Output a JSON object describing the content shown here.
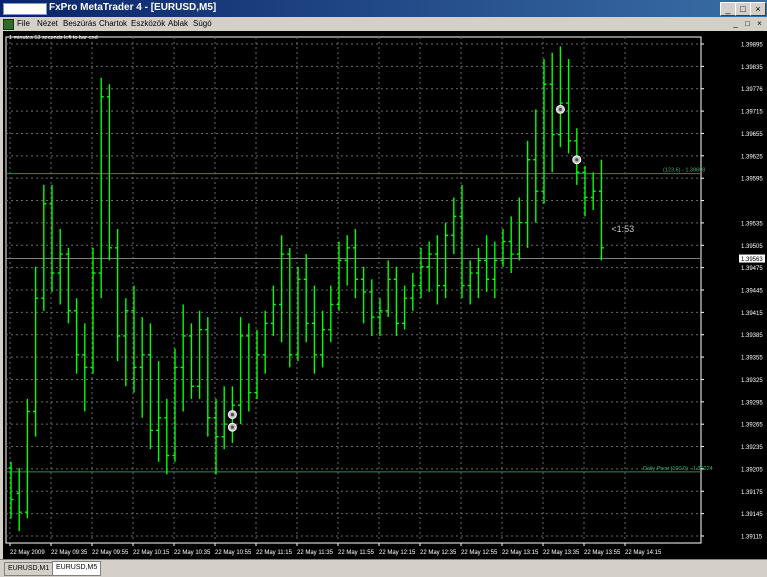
{
  "window": {
    "title": "FxPro MetaTrader 4 - [EURUSD,M5]",
    "controls": [
      "_",
      "□",
      "×"
    ]
  },
  "menu": {
    "items": [
      "File",
      "Nézet",
      "Beszúrás",
      "Chartok",
      "Eszközök",
      "Ablak",
      "Súgó"
    ],
    "doc_controls": [
      "_",
      "□",
      "×"
    ]
  },
  "chart": {
    "timer_text": "1 minutes 53 seconds left to bar end",
    "countdown_label": "<1:53",
    "current_price_label": "1.39563",
    "colors": {
      "background": "#000000",
      "bars": "#00ff00",
      "grid": "#6a6a6a",
      "axis_text": "#ffffff",
      "current_price_line": "#808080",
      "fibo_line": "#2e8b57",
      "fibo_text": "#3cb371"
    },
    "fibo_labels": {
      "upper_left": "(123.6) - ",
      "upper_value": "1.39698",
      "lower_left": "(100.0) - ",
      "lower_value": "1.39224",
      "lower_tag": "Daily Pivot"
    },
    "markers": [
      {
        "bar": 27,
        "price": 1.39295,
        "type": "circle-arrow"
      },
      {
        "bar": 27,
        "price": 1.39315,
        "type": "circle-arrow"
      },
      {
        "bar": 67,
        "price": 1.398,
        "type": "circle-arrow"
      },
      {
        "bar": 69,
        "price": 1.3972,
        "type": "circle-arrow"
      }
    ]
  },
  "chart_data": {
    "type": "ohlc",
    "symbol": "EURUSD",
    "timeframe": "M5",
    "price_axis_labels": [
      "1.39895",
      "1.39835",
      "1.39776",
      "1.39715",
      "1.39655",
      "1.39625",
      "1.39595",
      "1.39563",
      "1.39535",
      "1.39505",
      "1.39475",
      "1.39445",
      "1.39415",
      "1.39385",
      "1.39355",
      "1.39325",
      "1.39295",
      "1.39265",
      "1.39235",
      "1.39205",
      "1.39175",
      "1.39145",
      "1.39115"
    ],
    "time_axis_labels": [
      "22 May 2009",
      "22 May 09:35",
      "22 May 09:55",
      "22 May 10:15",
      "22 May 10:35",
      "22 May 10:55",
      "22 May 11:15",
      "22 May 11:35",
      "22 May 11:55",
      "22 May 12:15",
      "22 May 12:35",
      "22 May 12:55",
      "22 May 13:15",
      "22 May 13:35",
      "22 May 13:55",
      "22 May 14:15"
    ],
    "ylim": [
      1.39111,
      1.39915
    ],
    "current_price": 1.39563,
    "bars": [
      {
        "o": 1.3923,
        "h": 1.3924,
        "l": 1.3915,
        "c": 1.3918
      },
      {
        "o": 1.3919,
        "h": 1.3923,
        "l": 1.3913,
        "c": 1.3916
      },
      {
        "o": 1.3916,
        "h": 1.3934,
        "l": 1.3915,
        "c": 1.3932
      },
      {
        "o": 1.3932,
        "h": 1.3955,
        "l": 1.3928,
        "c": 1.395
      },
      {
        "o": 1.395,
        "h": 1.3968,
        "l": 1.3948,
        "c": 1.3965
      },
      {
        "o": 1.3965,
        "h": 1.3968,
        "l": 1.3951,
        "c": 1.3954
      },
      {
        "o": 1.3954,
        "h": 1.3961,
        "l": 1.3949,
        "c": 1.3957
      },
      {
        "o": 1.3957,
        "h": 1.3958,
        "l": 1.3946,
        "c": 1.3948
      },
      {
        "o": 1.3948,
        "h": 1.395,
        "l": 1.3938,
        "c": 1.3941
      },
      {
        "o": 1.3941,
        "h": 1.3946,
        "l": 1.3932,
        "c": 1.3939
      },
      {
        "o": 1.3939,
        "h": 1.3958,
        "l": 1.3938,
        "c": 1.3954
      },
      {
        "o": 1.3954,
        "h": 1.3985,
        "l": 1.395,
        "c": 1.3982
      },
      {
        "o": 1.3982,
        "h": 1.3984,
        "l": 1.3956,
        "c": 1.3958
      },
      {
        "o": 1.3958,
        "h": 1.3961,
        "l": 1.394,
        "c": 1.3944
      },
      {
        "o": 1.3944,
        "h": 1.395,
        "l": 1.3936,
        "c": 1.3948
      },
      {
        "o": 1.3948,
        "h": 1.3952,
        "l": 1.3935,
        "c": 1.3939
      },
      {
        "o": 1.3939,
        "h": 1.3947,
        "l": 1.3931,
        "c": 1.3941
      },
      {
        "o": 1.3941,
        "h": 1.3946,
        "l": 1.3926,
        "c": 1.3929
      },
      {
        "o": 1.3929,
        "h": 1.394,
        "l": 1.3924,
        "c": 1.3931
      },
      {
        "o": 1.3931,
        "h": 1.3934,
        "l": 1.3922,
        "c": 1.3925
      },
      {
        "o": 1.3925,
        "h": 1.3942,
        "l": 1.3924,
        "c": 1.3939
      },
      {
        "o": 1.3939,
        "h": 1.3949,
        "l": 1.3932,
        "c": 1.3944
      },
      {
        "o": 1.3944,
        "h": 1.3946,
        "l": 1.3934,
        "c": 1.3936
      },
      {
        "o": 1.3936,
        "h": 1.3948,
        "l": 1.3934,
        "c": 1.3945
      },
      {
        "o": 1.3945,
        "h": 1.3947,
        "l": 1.3928,
        "c": 1.3931
      },
      {
        "o": 1.3931,
        "h": 1.3934,
        "l": 1.3922,
        "c": 1.3928
      },
      {
        "o": 1.3928,
        "h": 1.3936,
        "l": 1.3926,
        "c": 1.393
      },
      {
        "o": 1.393,
        "h": 1.3936,
        "l": 1.3927,
        "c": 1.3933
      },
      {
        "o": 1.3933,
        "h": 1.3947,
        "l": 1.393,
        "c": 1.3944
      },
      {
        "o": 1.3944,
        "h": 1.3946,
        "l": 1.3932,
        "c": 1.3935
      },
      {
        "o": 1.3935,
        "h": 1.3945,
        "l": 1.3934,
        "c": 1.3941
      },
      {
        "o": 1.3941,
        "h": 1.3948,
        "l": 1.3938,
        "c": 1.3946
      },
      {
        "o": 1.3946,
        "h": 1.3952,
        "l": 1.3944,
        "c": 1.3949
      },
      {
        "o": 1.3949,
        "h": 1.396,
        "l": 1.3943,
        "c": 1.3957
      },
      {
        "o": 1.3957,
        "h": 1.3958,
        "l": 1.3939,
        "c": 1.3941
      },
      {
        "o": 1.3941,
        "h": 1.3955,
        "l": 1.394,
        "c": 1.3953
      },
      {
        "o": 1.3953,
        "h": 1.3957,
        "l": 1.3943,
        "c": 1.3946
      },
      {
        "o": 1.3946,
        "h": 1.3952,
        "l": 1.3938,
        "c": 1.3941
      },
      {
        "o": 1.3941,
        "h": 1.3948,
        "l": 1.3939,
        "c": 1.3945
      },
      {
        "o": 1.3945,
        "h": 1.3952,
        "l": 1.3943,
        "c": 1.3949
      },
      {
        "o": 1.3949,
        "h": 1.3959,
        "l": 1.3948,
        "c": 1.3956
      },
      {
        "o": 1.3956,
        "h": 1.396,
        "l": 1.3952,
        "c": 1.3958
      },
      {
        "o": 1.3958,
        "h": 1.3961,
        "l": 1.395,
        "c": 1.3953
      },
      {
        "o": 1.3953,
        "h": 1.3955,
        "l": 1.3946,
        "c": 1.3951
      },
      {
        "o": 1.3951,
        "h": 1.3953,
        "l": 1.3944,
        "c": 1.3947
      },
      {
        "o": 1.3947,
        "h": 1.395,
        "l": 1.3944,
        "c": 1.3948
      },
      {
        "o": 1.3948,
        "h": 1.3956,
        "l": 1.3947,
        "c": 1.3953
      },
      {
        "o": 1.3953,
        "h": 1.3955,
        "l": 1.3944,
        "c": 1.3946
      },
      {
        "o": 1.3946,
        "h": 1.3952,
        "l": 1.3945,
        "c": 1.395
      },
      {
        "o": 1.395,
        "h": 1.3954,
        "l": 1.3948,
        "c": 1.3952
      },
      {
        "o": 1.3952,
        "h": 1.3958,
        "l": 1.395,
        "c": 1.3955
      },
      {
        "o": 1.3955,
        "h": 1.3959,
        "l": 1.3951,
        "c": 1.3957
      },
      {
        "o": 1.3957,
        "h": 1.396,
        "l": 1.3949,
        "c": 1.3952
      },
      {
        "o": 1.3952,
        "h": 1.3962,
        "l": 1.395,
        "c": 1.396
      },
      {
        "o": 1.396,
        "h": 1.3966,
        "l": 1.3957,
        "c": 1.3963
      },
      {
        "o": 1.3963,
        "h": 1.3968,
        "l": 1.395,
        "c": 1.3952
      },
      {
        "o": 1.3952,
        "h": 1.3956,
        "l": 1.3949,
        "c": 1.3954
      },
      {
        "o": 1.3954,
        "h": 1.3958,
        "l": 1.395,
        "c": 1.3956
      },
      {
        "o": 1.3956,
        "h": 1.396,
        "l": 1.3951,
        "c": 1.3953
      },
      {
        "o": 1.3953,
        "h": 1.3959,
        "l": 1.395,
        "c": 1.3956
      },
      {
        "o": 1.3956,
        "h": 1.3961,
        "l": 1.3955,
        "c": 1.3959
      },
      {
        "o": 1.3959,
        "h": 1.3963,
        "l": 1.3954,
        "c": 1.3957
      },
      {
        "o": 1.3957,
        "h": 1.3966,
        "l": 1.3956,
        "c": 1.3962
      },
      {
        "o": 1.3962,
        "h": 1.3975,
        "l": 1.3958,
        "c": 1.3972
      },
      {
        "o": 1.3972,
        "h": 1.398,
        "l": 1.3962,
        "c": 1.3967
      },
      {
        "o": 1.3967,
        "h": 1.3988,
        "l": 1.3965,
        "c": 1.3984
      },
      {
        "o": 1.3984,
        "h": 1.3989,
        "l": 1.397,
        "c": 1.3976
      },
      {
        "o": 1.3976,
        "h": 1.399,
        "l": 1.3974,
        "c": 1.3981
      },
      {
        "o": 1.3981,
        "h": 1.3988,
        "l": 1.3973,
        "c": 1.3975
      },
      {
        "o": 1.3975,
        "h": 1.3977,
        "l": 1.3968,
        "c": 1.397
      },
      {
        "o": 1.397,
        "h": 1.3971,
        "l": 1.3963,
        "c": 1.3966
      },
      {
        "o": 1.3966,
        "h": 1.397,
        "l": 1.3964,
        "c": 1.3967
      },
      {
        "o": 1.3967,
        "h": 1.3972,
        "l": 1.3956,
        "c": 1.3958
      }
    ]
  }
}
